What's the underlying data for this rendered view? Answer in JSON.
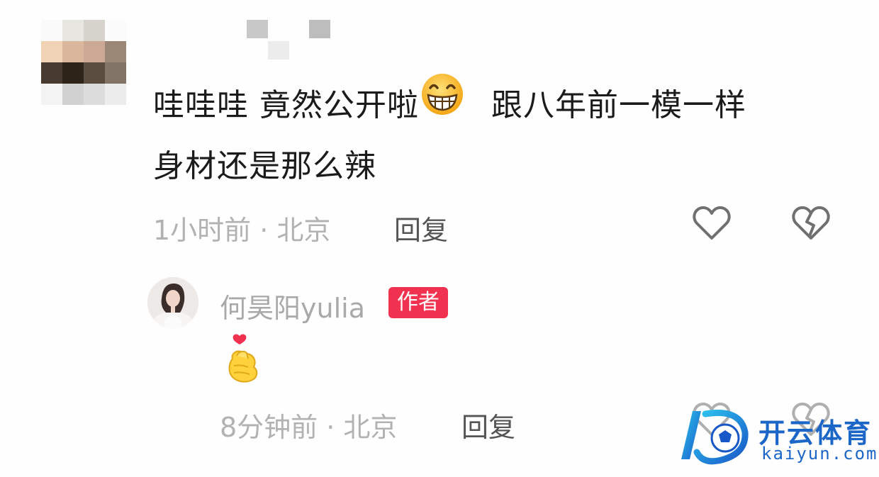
{
  "comment": {
    "line1_part1": "哇哇哇  竟然公开啦",
    "line1_part2": "跟八年前一模一样",
    "line2": "身材还是那么辣",
    "emoji": "grinning-face-icon",
    "meta": "1小时前 · 北京",
    "reply_label": "回复"
  },
  "reply": {
    "author_name": "何昊阳yulia",
    "author_badge": "作者",
    "content_emoji": "finger-heart-icon",
    "meta": "8分钟前 · 北京",
    "reply_label": "回复"
  },
  "watermark": {
    "brand_cn": "开云体育",
    "brand_en": "kaiyun.com"
  },
  "colors": {
    "badge": "#f0314f",
    "meta_text": "#b2b2b2",
    "reply_text": "#555555",
    "brand": "#1b66c6"
  }
}
